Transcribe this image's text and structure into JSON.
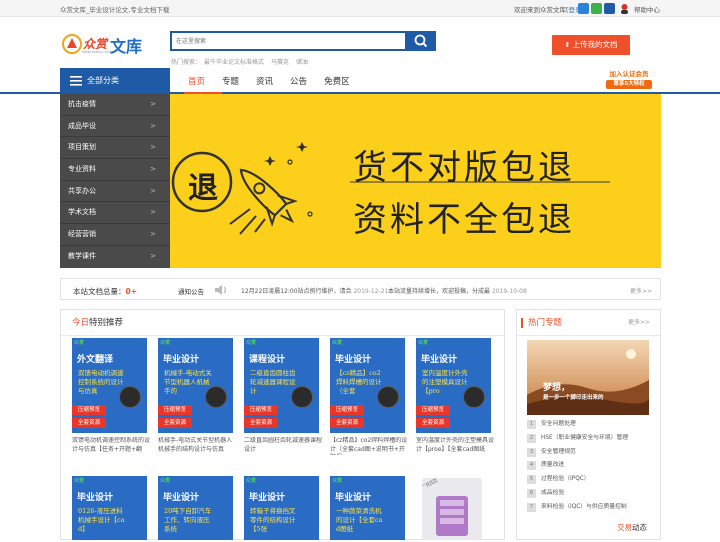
{
  "topbar": {
    "left_text": "众赏文库_毕业设计论文,专业文档下载",
    "welcome": "欢迎来到众赏文库",
    "login_open": "[",
    "login": "登录",
    "login_close": "]",
    "help": "帮助中心"
  },
  "logo": {
    "mark": "众赏",
    "sub": "文库",
    "small": "www.zsdocx.com"
  },
  "search": {
    "placeholder": "在这里搜索",
    "hot_label": "热门搜索：",
    "hot_terms": [
      "最牛毕业论文标准格式",
      "马赛克",
      "储油"
    ]
  },
  "upload_button": "上传我的文档",
  "nav": {
    "all_categories": "全部分类",
    "items": [
      "首页",
      "专题",
      "资讯",
      "公告",
      "免费区"
    ],
    "active_index": 0
  },
  "promo": {
    "line1": "加入认证会员",
    "line2": "尊享5大特权"
  },
  "sidebar": {
    "items": [
      "抗击疫情",
      "成品毕设",
      "项目策划",
      "专业资料",
      "共享办公",
      "学术文档",
      "经营营销",
      "教学课件"
    ],
    "chevron": ">"
  },
  "banner": {
    "icon_char": "退",
    "line1": "货不对版包退",
    "line2": "资料不全包退"
  },
  "stats": {
    "total_label": "本站文档总量：",
    "total_value": "0+",
    "notice_label": "通知公告",
    "notice1": "12月22日凌晨12:00站点例行维护，请合",
    "notice1_date": "2019-12-21",
    "notice2": "本站流量持续增长，欢迎投稿，分成最",
    "notice2_date": "2019-10-08",
    "more": "更多>>"
  },
  "recommend": {
    "title_highlight": "今日",
    "title_rest": "特别推荐",
    "cards": [
      {
        "title": "外文翻译",
        "subtitle": "双馈电动机调速控制系统的设计与仿真",
        "caption": "双馈电动机调速控制系统的设计与仿真【任务+开题+翻"
      },
      {
        "title": "毕业设计",
        "subtitle": "机械手-电动式关节型机器人机械手的",
        "caption": "机械手-电动式关节型机器人机械手的结构设计与仿真"
      },
      {
        "title": "课程设计",
        "subtitle": "二级直齿圆柱齿轮减速器课程设计",
        "caption": "二级直齿圆柱齿轮减速器课程设计"
      },
      {
        "title": "毕业设计",
        "subtitle": "【cz精品】co2焊料焊槽的设计（全套",
        "caption": "【cz精品】co2焊料焊槽的设计（全套cad图+说明书+开题报"
      },
      {
        "title": "毕业设计",
        "subtitle": "室内温度计外壳的注塑模具设计【pro",
        "caption": "室内温度计外壳的注塑模具设计【proe】【全套cad图纸"
      },
      {
        "title": "毕业设计",
        "subtitle": "0126-液压进料机械手设计【cad】",
        "caption": ""
      },
      {
        "title": "毕业设计",
        "subtitle": "20吨下自卸汽车工作、转向液压系统",
        "caption": ""
      },
      {
        "title": "毕业设计",
        "subtitle": "转箱子将换挡叉零件的结构设计【5张",
        "caption": ""
      },
      {
        "title": "毕业设计",
        "subtitle": "一种蔬菜清洗机的设计【全套cad图纸",
        "caption": ""
      }
    ],
    "tag_top": "压缩预览",
    "tag_bottom": "全套资源",
    "badge": "众赏",
    "rar_label": "RAR"
  },
  "hot_topics": {
    "title": "热门专题",
    "more": "更多>>",
    "image_text1": "梦想，",
    "image_text2": "是一步一个脚印走出来的",
    "list": [
      {
        "n": "1",
        "text": "安全问题处理"
      },
      {
        "n": "2",
        "text": "HSE（职业健康安全与环境）管理"
      },
      {
        "n": "3",
        "text": "安全管理规范"
      },
      {
        "n": "4",
        "text": "质量改进"
      },
      {
        "n": "5",
        "text": "过程检验（IPQC）"
      },
      {
        "n": "6",
        "text": "成品检验"
      },
      {
        "n": "7",
        "text": "来料检验（IQC）与供应质量控制"
      }
    ]
  },
  "trade": {
    "highlight": "交易",
    "rest": "动态"
  },
  "colors": {
    "brand_blue": "#1f5aa6",
    "accent_orange": "#ef4f2a",
    "banner_yellow": "#fccf1a",
    "sidebar_gray": "#4a4a4a"
  }
}
